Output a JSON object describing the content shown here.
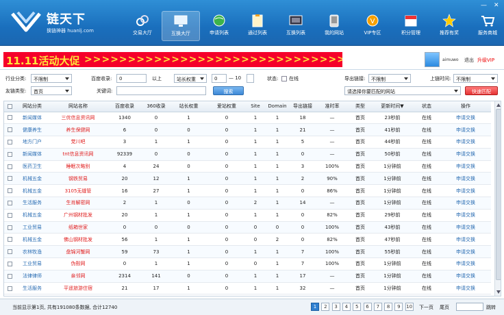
{
  "brand": {
    "name": "链天下",
    "subtitle": "换链神器 huanlj.com"
  },
  "nav": [
    {
      "label": "交易大厅",
      "icon": "link-icon"
    },
    {
      "label": "互换大厅",
      "icon": "monitor-icon"
    },
    {
      "label": "申请列表",
      "icon": "globe-icon"
    },
    {
      "label": "通过列表",
      "icon": "clipboard-icon"
    },
    {
      "label": "互换列表",
      "icon": "screen-list-icon"
    },
    {
      "label": "我的网站",
      "icon": "phone-icon"
    },
    {
      "label": "VIP专区",
      "icon": "vip-icon"
    },
    {
      "label": "积分管理",
      "icon": "calendar-icon"
    },
    {
      "label": "推荐有奖",
      "icon": "star-icon"
    },
    {
      "label": "服务商城",
      "icon": "cart-icon"
    }
  ],
  "window": {
    "min": "—",
    "close": "✕"
  },
  "promo": {
    "title": "11.11活动大促",
    "arrows": ">>>>>>>>>>>>>>>>>>>>>>>>>>>>>>>>"
  },
  "user": {
    "name": "aimuwo",
    "logout": "退出",
    "upgrade": "升级VIP"
  },
  "filters": {
    "industry_label": "行业分类:",
    "industry_value": "不限制",
    "baidu_label": "百度收录:",
    "baidu_value": "0",
    "baidu_suffix": "以上",
    "weight_select": "站长权重",
    "weight_from": "0",
    "weight_sep": "— 10",
    "status_label": "状态:",
    "status_option": "在线",
    "export_label": "导出链接:",
    "export_value": "不限制",
    "online_label": "上链时间:",
    "online_value": "不限制",
    "friend_label": "友链类型:",
    "friend_value": "首页",
    "keyword_label": "关键词:",
    "keyword_value": "",
    "search_btn": "搜索",
    "match_select": "请选择你要匹配的网站",
    "quick_btn": "快速匹配"
  },
  "table": {
    "headers": [
      "网站分类",
      "网站名称",
      "百度收录",
      "360收录",
      "站长权重",
      "爱站权重",
      "Site",
      "Domain",
      "导出链接",
      "准时率",
      "类型",
      "更新时间▼",
      "状态",
      "操作"
    ],
    "rows": [
      [
        "新闻媒体",
        "三优信息资讯网",
        "1340",
        "0",
        "1",
        "0",
        "1",
        "1",
        "18",
        "—",
        "首页",
        "23秒前",
        "在线",
        "申请交换"
      ],
      [
        "健康养生",
        "养生保健网",
        "6",
        "0",
        "0",
        "0",
        "1",
        "1",
        "21",
        "—",
        "首页",
        "41秒前",
        "在线",
        "申请交换"
      ],
      [
        "地方门户",
        "党川吧",
        "3",
        "1",
        "1",
        "0",
        "1",
        "1",
        "5",
        "—",
        "首页",
        "44秒前",
        "在线",
        "申请交换"
      ],
      [
        "新闻媒体",
        "tnt信息资讯网",
        "92339",
        "0",
        "0",
        "0",
        "1",
        "1",
        "0",
        "—",
        "首页",
        "50秒前",
        "在线",
        "申请交换"
      ],
      [
        "医药卫生",
        "睡眠次略别",
        "4",
        "24",
        "0",
        "0",
        "1",
        "1",
        "3",
        "100%",
        "首页",
        "1分钟前",
        "在线",
        "申请交换"
      ],
      [
        "机械五金",
        "钢铁贸易",
        "20",
        "12",
        "1",
        "0",
        "1",
        "1",
        "2",
        "90%",
        "首页",
        "1分钟前",
        "在线",
        "申请交换"
      ],
      [
        "机械五金",
        "3105无缝管",
        "16",
        "27",
        "1",
        "0",
        "1",
        "1",
        "0",
        "86%",
        "首页",
        "1分钟前",
        "在线",
        "申请交换"
      ],
      [
        "生活服务",
        "生肖解密网",
        "2",
        "1",
        "0",
        "0",
        "2",
        "1",
        "14",
        "—",
        "首页",
        "1分钟前",
        "在线",
        "申请交换"
      ],
      [
        "机械五金",
        "广州钢材批发",
        "20",
        "1",
        "1",
        "0",
        "1",
        "1",
        "0",
        "82%",
        "首页",
        "29秒前",
        "在线",
        "申请交换"
      ],
      [
        "工业贸易",
        "纸箱世家",
        "0",
        "0",
        "0",
        "0",
        "0",
        "0",
        "0",
        "100%",
        "首页",
        "43秒前",
        "在线",
        "申请交换"
      ],
      [
        "机械五金",
        "佛山钢材批发",
        "56",
        "1",
        "1",
        "0",
        "0",
        "2",
        "0",
        "82%",
        "首页",
        "47秒前",
        "在线",
        "申请交换"
      ],
      [
        "农林牧渔",
        "盘锦河蟹网",
        "59",
        "73",
        "1",
        "0",
        "1",
        "1",
        "7",
        "100%",
        "首页",
        "55秒前",
        "在线",
        "申请交换"
      ],
      [
        "工业贸易",
        "伪毂网",
        "0",
        "1",
        "1",
        "0",
        "0",
        "1",
        "7",
        "100%",
        "首页",
        "1分钟前",
        "在线",
        "申请交换"
      ],
      [
        "法律律师",
        "亲邻网",
        "2314",
        "141",
        "0",
        "0",
        "1",
        "1",
        "17",
        "—",
        "首页",
        "1分钟前",
        "在线",
        "申请交换"
      ],
      [
        "生活服务",
        "平遥旅游住宿",
        "21",
        "17",
        "1",
        "0",
        "1",
        "1",
        "32",
        "—",
        "首页",
        "1分钟前",
        "在线",
        "申请交换"
      ]
    ]
  },
  "footer": {
    "info": "当前显示第1页, 共有191080条数据, 合计12740",
    "pages": [
      "1",
      "2",
      "3",
      "4",
      "5",
      "6",
      "7",
      "8",
      "9",
      "10"
    ],
    "next": "下一页",
    "last": "尾页",
    "goto": "跳转"
  },
  "colors": {
    "header": "#1a6fbd",
    "promo": "#f5002a",
    "promo_text": "#ffe53a",
    "link": "#2a6db3",
    "site": "#e01e1e"
  }
}
